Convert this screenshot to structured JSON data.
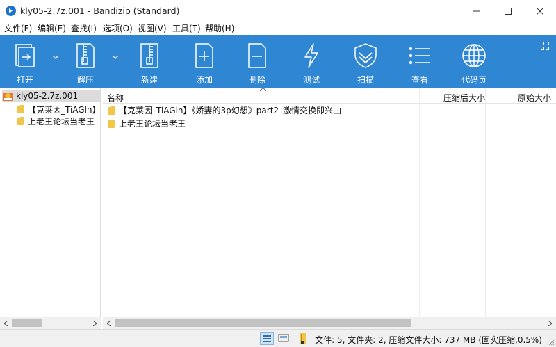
{
  "window": {
    "title": "kly05-2.7z.001 - Bandizip (Standard)"
  },
  "menu": [
    {
      "label": "文件(F)"
    },
    {
      "label": "编辑(E)"
    },
    {
      "label": "查找(I)"
    },
    {
      "label": "选项(O)"
    },
    {
      "label": "视图(V)"
    },
    {
      "label": "工具(T)"
    },
    {
      "label": "帮助(H)"
    }
  ],
  "toolbar": {
    "accent": "#2f86d2",
    "buttons": [
      {
        "label": "打开",
        "icon": "open-archive-icon"
      },
      {
        "label": "解压",
        "icon": "extract-zipper-icon"
      },
      {
        "label": "新建",
        "icon": "new-archive-icon"
      },
      {
        "label": "添加",
        "icon": "add-file-icon"
      },
      {
        "label": "删除",
        "icon": "delete-file-icon"
      },
      {
        "label": "测试",
        "icon": "lightning-test-icon"
      },
      {
        "label": "扫描",
        "icon": "shield-scan-icon"
      },
      {
        "label": "查看",
        "icon": "list-view-icon"
      },
      {
        "label": "代码页",
        "icon": "globe-icon"
      }
    ]
  },
  "tree": {
    "root": "kly05-2.7z.001",
    "children": [
      {
        "label": "【克莱因_TiAGln】"
      },
      {
        "label": "上老王论坛当老王"
      }
    ]
  },
  "list": {
    "columns": {
      "name": "名称",
      "compressed": "压缩后大小",
      "original": "原始大小"
    },
    "rows": [
      {
        "name": "【克莱因_TiAGln】《娇妻的3p幻想》part2_激情交换即兴曲"
      },
      {
        "name": "上老王论坛当老王"
      }
    ]
  },
  "status": {
    "text": "文件: 5, 文件夹: 2, 压缩文件大小: 737 MB (固实压缩,0.5%)"
  }
}
